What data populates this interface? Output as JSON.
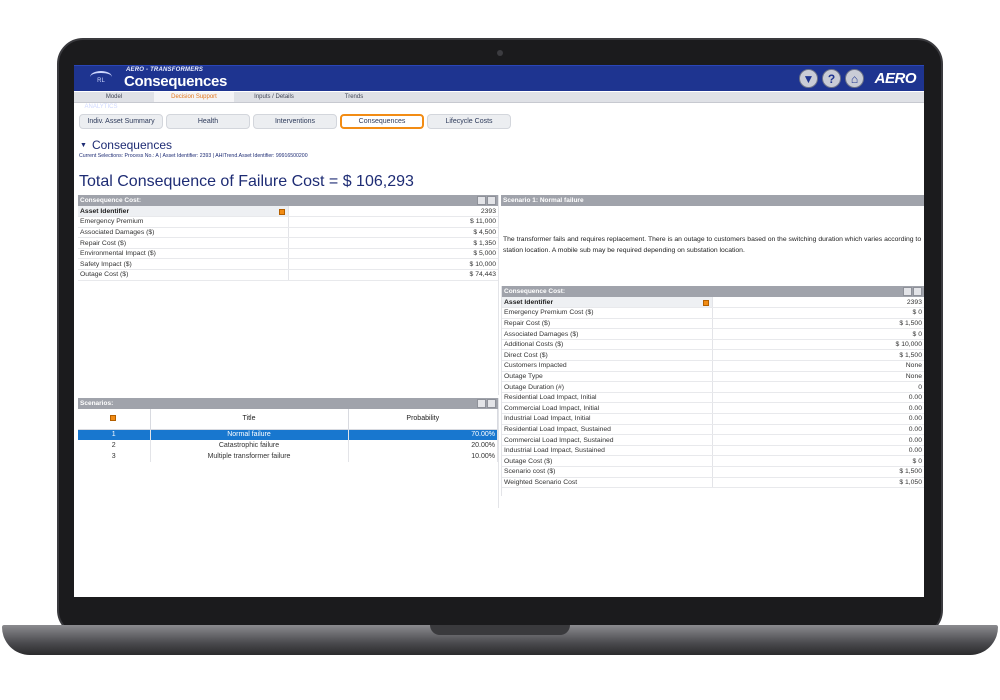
{
  "app": {
    "subtitle": "AERO - TRANSFORMERS",
    "title": "Consequences",
    "brand": "AERO",
    "logo_text": "RL ANALYTICS",
    "header_icons": [
      {
        "icon": "filter-icon",
        "glyph": "▼"
      },
      {
        "icon": "help-icon",
        "glyph": "?"
      },
      {
        "icon": "home-icon",
        "glyph": "⌂"
      }
    ]
  },
  "nav_tabs": [
    {
      "label": "Model"
    },
    {
      "label": "Decision Support",
      "active": true
    },
    {
      "label": "Inputs / Details"
    },
    {
      "label": "Trends"
    }
  ],
  "sub_tabs": [
    {
      "label": "Indiv. Asset Summary"
    },
    {
      "label": "Health"
    },
    {
      "label": "Interventions"
    },
    {
      "label": "Consequences",
      "active": true
    },
    {
      "label": "Lifecycle Costs"
    }
  ],
  "section_title": "Consequences",
  "current_selections": "Current Selections: Process No.: A | Asset Identifier: 2393 | AHITrend.Asset Identifier: 99916500200",
  "total_cost": "Total Consequence of Failure Cost  =  $ 106,293",
  "consequence_cost_panel": {
    "title": "Consequence Cost:",
    "rows": [
      {
        "label": "Asset Identifier",
        "value": "2393"
      },
      {
        "label": "Emergency Premium",
        "value": "$ 11,000"
      },
      {
        "label": "Associated Damages ($)",
        "value": "$ 4,500"
      },
      {
        "label": "Repair Cost ($)",
        "value": "$ 1,350"
      },
      {
        "label": "Environmental Impact ($)",
        "value": "$ 5,000"
      },
      {
        "label": "Safety Impact ($)",
        "value": "$ 10,000"
      },
      {
        "label": "Outage Cost ($)",
        "value": "$ 74,443"
      }
    ]
  },
  "scenario_panel": {
    "title": "Scenario 1: Normal failure",
    "description": "The transformer fails and requires replacement.   There is an outage to customers based on the switching duration which varies according to station location.  A mobile sub may be required depending on substation location."
  },
  "scenario_cost_panel": {
    "title": "Consequence Cost:",
    "rows": [
      {
        "label": "Asset Identifier",
        "value": "2393"
      },
      {
        "label": "Emergency Premium Cost ($)",
        "value": "$ 0"
      },
      {
        "label": "Repair Cost ($)",
        "value": "$ 1,500"
      },
      {
        "label": "Associated Damages ($)",
        "value": "$ 0"
      },
      {
        "label": "Additional Costs ($)",
        "value": "$ 10,000"
      },
      {
        "label": "Direct Cost ($)",
        "value": "$ 1,500"
      },
      {
        "label": "Customers Impacted",
        "value": "None"
      },
      {
        "label": "Outage Type",
        "value": "None"
      },
      {
        "label": "Outage Duration (#)",
        "value": "0"
      },
      {
        "label": "Residential Load Impact, Initial",
        "value": "0.00"
      },
      {
        "label": "Commercial Load Impact, Initial",
        "value": "0.00"
      },
      {
        "label": "Industrial Load Impact, Initial",
        "value": "0.00"
      },
      {
        "label": "Residential Load Impact, Sustained",
        "value": "0.00"
      },
      {
        "label": "Commercial Load Impact, Sustained",
        "value": "0.00"
      },
      {
        "label": "Industrial Load Impact, Sustained",
        "value": "0.00"
      },
      {
        "label": "Outage Cost ($)",
        "value": "$ 0"
      },
      {
        "label": "Scenario cost ($)",
        "value": "$ 1,500"
      },
      {
        "label": "Weighted Scenario Cost",
        "value": "$ 1,050"
      }
    ]
  },
  "scenarios_panel": {
    "title": "Scenarios:",
    "columns": [
      "Title",
      "Probability"
    ],
    "rows": [
      {
        "idx": "1",
        "title": "Normal failure",
        "probability": "70.00%",
        "selected": true
      },
      {
        "idx": "2",
        "title": "Catastrophic failure",
        "probability": "20.00%"
      },
      {
        "idx": "3",
        "title": "Multiple transformer failure",
        "probability": "10.00%"
      }
    ]
  },
  "colors": {
    "header_blue": "#1e3490",
    "accent_orange": "#f28c14",
    "selection_blue": "#1877cf",
    "panel_header_gray": "#a0a3ab"
  }
}
